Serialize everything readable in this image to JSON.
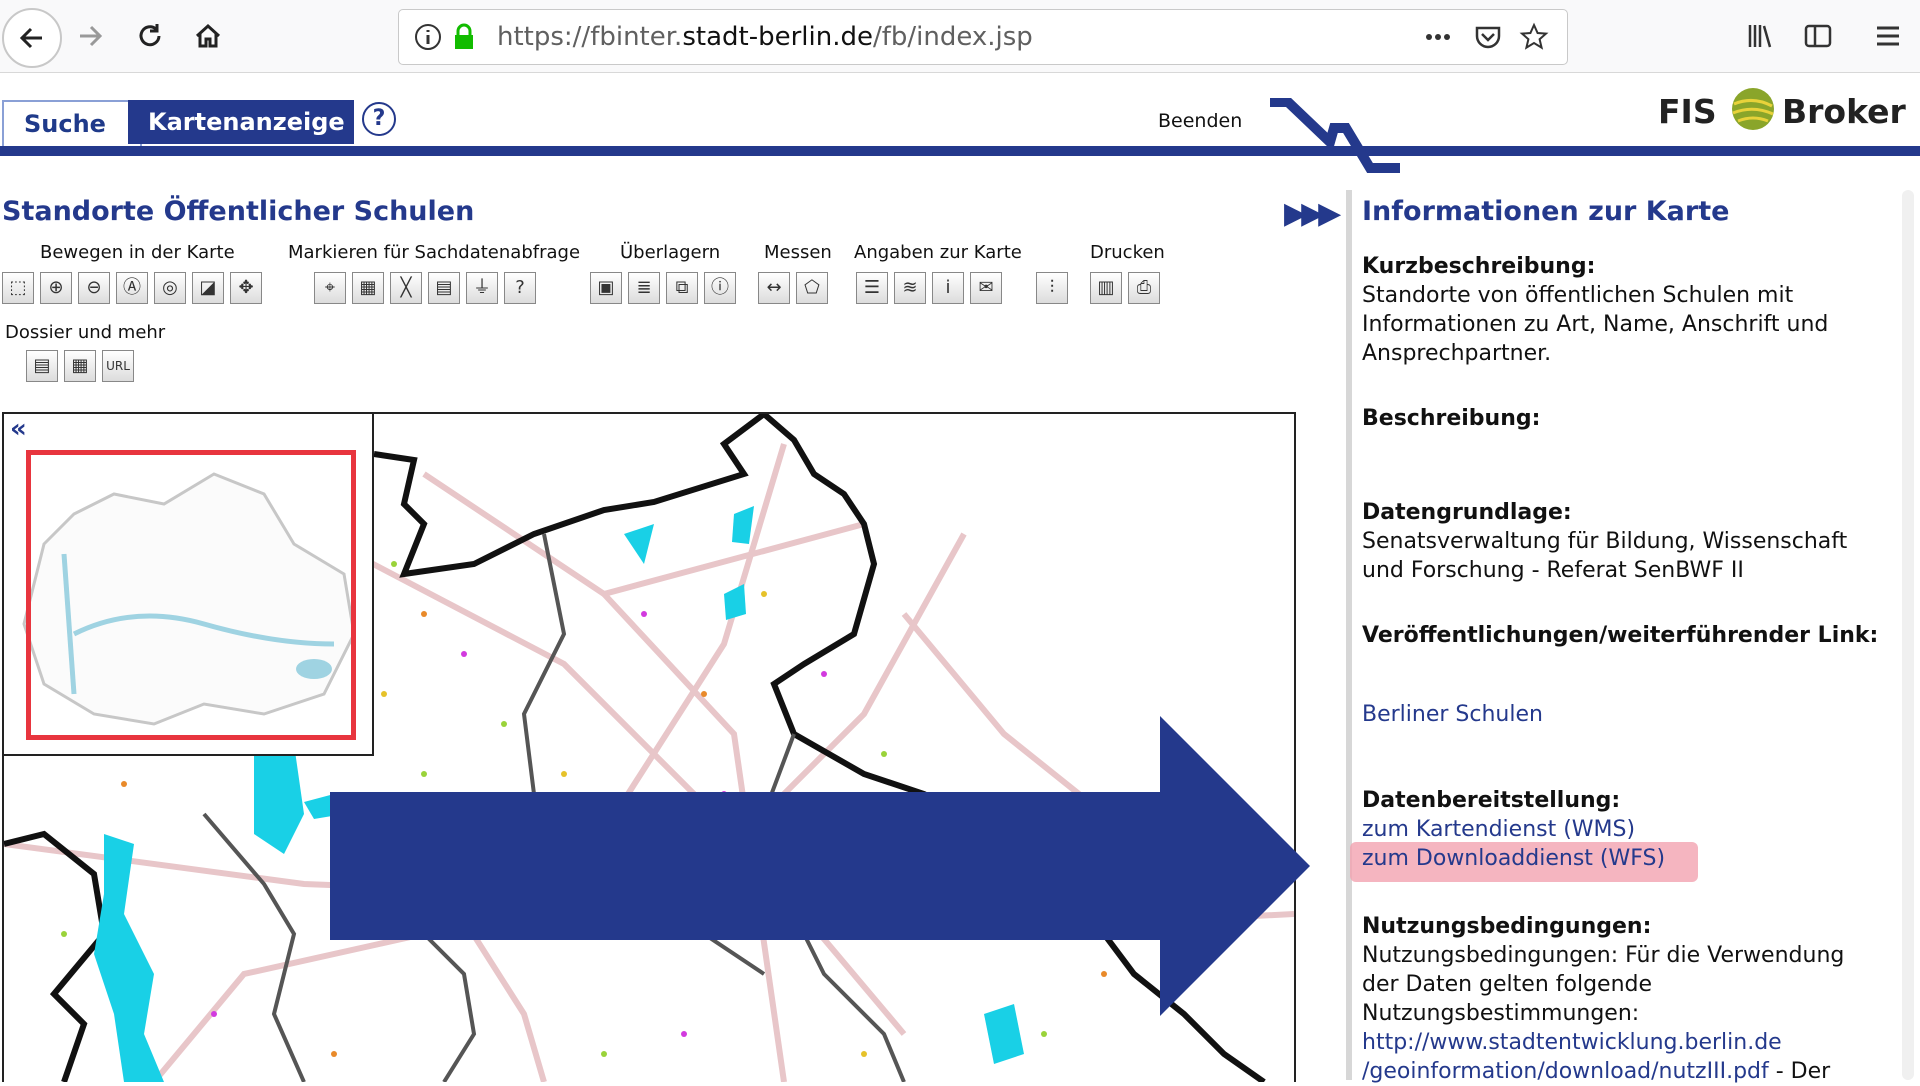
{
  "browser": {
    "url_prefix": "https://fbinter.",
    "url_domain": "stadt-berlin.de",
    "url_path": "/fb/index.jsp"
  },
  "header": {
    "tab_search": "Suche",
    "tab_map": "Kartenanzeige",
    "help": "?",
    "quit": "Beenden",
    "logo_left": "FIS",
    "logo_right": "Broker"
  },
  "map_panel": {
    "title": "Standorte Öffentlicher Schulen",
    "expand": "▶▶▶",
    "groups": [
      {
        "label": "Bewegen in der Karte"
      },
      {
        "label": "Markieren für Sachdatenabfrage"
      },
      {
        "label": "Überlagern"
      },
      {
        "label": "Messen"
      },
      {
        "label": "Angaben zur Karte"
      },
      {
        "label": "Drucken"
      }
    ],
    "dossier_label": "Dossier und mehr",
    "overview_collapse": "«"
  },
  "info_panel": {
    "title": "Informationen zur Karte",
    "short_heading": "Kurzbeschreibung:",
    "short_text": "Standorte von öffentlichen Schulen mit Informationen zu Art, Name, Anschrift und Ansprechpartner.",
    "desc_heading": "Beschreibung:",
    "basis_heading": "Datengrundlage:",
    "basis_text": "Senatsverwaltung für Bildung, Wissenschaft und Forschung - Referat SenBWF II",
    "pub_heading": "Veröffentlichungen/weiterführender Link:",
    "pub_link": "Berliner Schulen",
    "provision_heading": "Datenbereitstellung:",
    "wms_link": "zum Kartendienst (WMS)",
    "wfs_link": "zum Downloaddienst (WFS)",
    "terms_heading": "Nutzungsbedingungen:",
    "terms_text": "Nutzungsbedingungen: Für die Verwendung der Daten gelten folgende Nutzungsbestimmungen:",
    "terms_link_1": "http://www.stadtentwicklung.berlin.de",
    "terms_link_2": "/geoinformation/download/nutzIII.pdf",
    "terms_tail": " - Der"
  },
  "colors": {
    "brand_blue": "#24398c",
    "highlight": "#f2a2b0",
    "water": "#19d0e6",
    "district_border": "#111111"
  }
}
